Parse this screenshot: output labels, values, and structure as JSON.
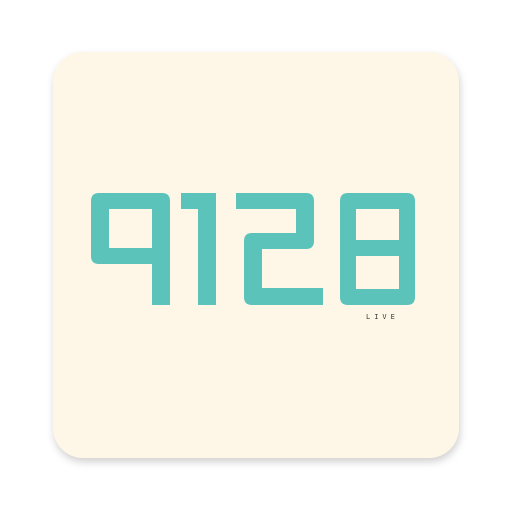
{
  "app_icon": {
    "logo_text": "9128",
    "sub_label": "LIVE",
    "colors": {
      "tile_background": "#fef7e7",
      "logo_teal": "#5cc3bb",
      "sub_label": "#3a3a3a"
    }
  }
}
